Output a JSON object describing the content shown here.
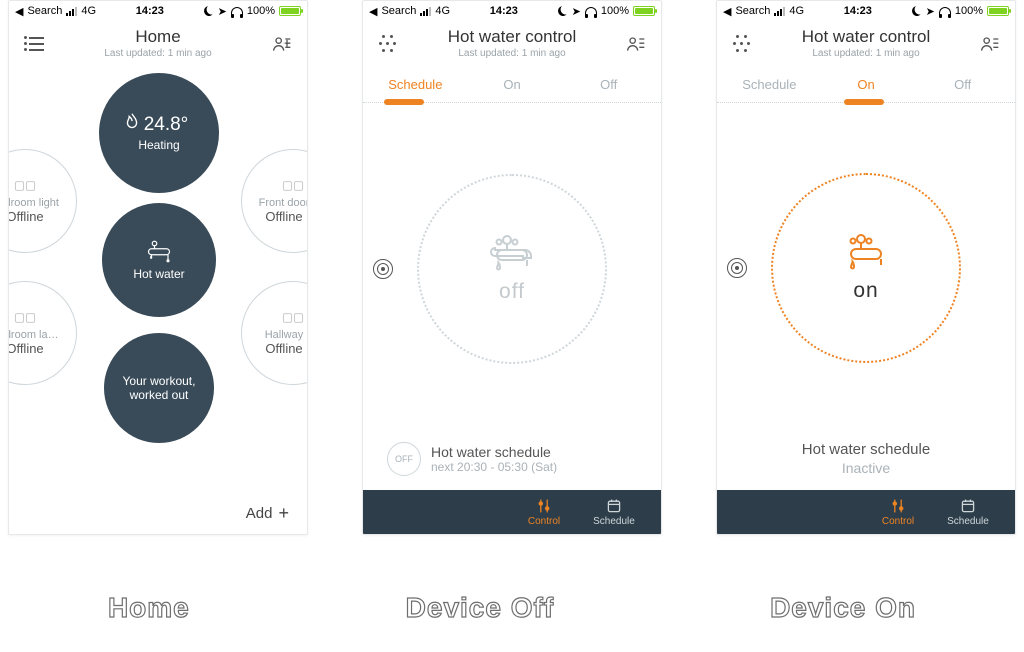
{
  "status_bar": {
    "carrier_back": "Search",
    "network": "4G",
    "time": "14:23",
    "battery_pct": "100%"
  },
  "captions": {
    "home": "Home",
    "off": "Device Off",
    "on": "Device On"
  },
  "screen_home": {
    "title": "Home",
    "subtitle": "Last updated: 1 min ago",
    "tiles": {
      "heating": {
        "temp": "24.8°",
        "label": "Heating"
      },
      "hotwater": {
        "label": "Hot water"
      },
      "workout": {
        "line1": "Your workout,",
        "line2": "worked out"
      },
      "bedroom_light": {
        "name": "Bedroom light",
        "state": "Offline"
      },
      "bedroom_la": {
        "name": "Bedroom la…",
        "state": "Offline"
      },
      "front_door": {
        "name": "Front door",
        "state": "Offline"
      },
      "hallway": {
        "name": "Hallway",
        "state": "Offline"
      }
    },
    "add_label": "Add"
  },
  "screen_control": {
    "title": "Hot water control",
    "subtitle": "Last updated: 1 min ago",
    "segments": {
      "schedule": "Schedule",
      "on": "On",
      "off": "Off"
    },
    "off_state_label": "off",
    "on_state_label": "on",
    "schedule_off": {
      "pill": "OFF",
      "title": "Hot water schedule",
      "next": "next 20:30 - 05:30 (Sat)"
    },
    "schedule_on": {
      "title": "Hot water schedule",
      "state": "Inactive"
    },
    "tabs": {
      "control": "Control",
      "schedule": "Schedule"
    }
  }
}
